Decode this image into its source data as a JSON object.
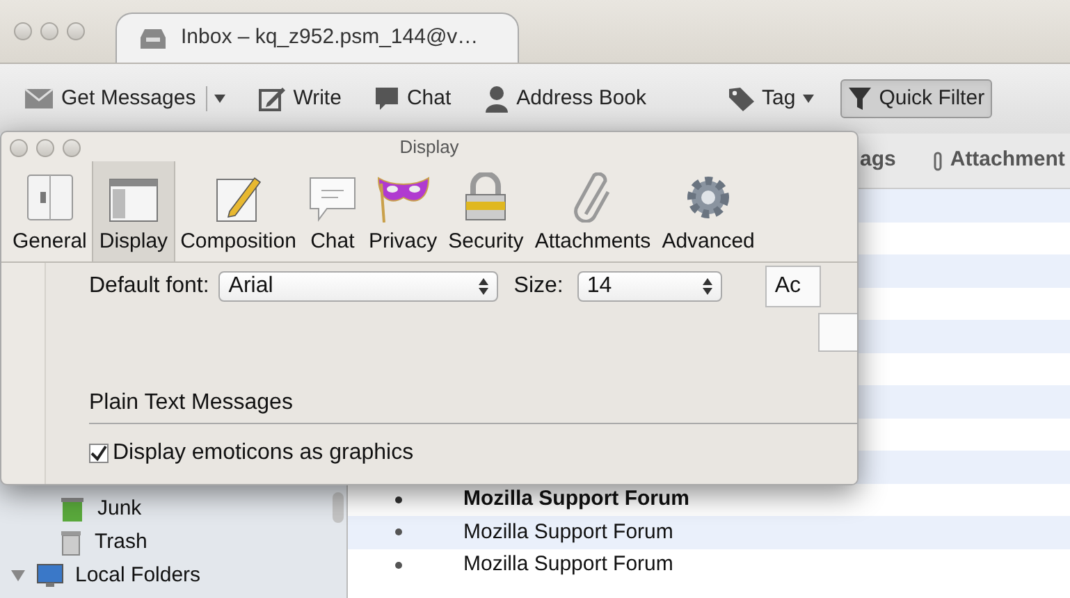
{
  "window": {
    "tab": {
      "title": "Inbox – kq_z952.psm_144@v…",
      "selected": true
    }
  },
  "toolbar": [
    {
      "label": "Get Messages",
      "kind": "split",
      "pressed": false
    },
    {
      "label": "Write",
      "kind": "button",
      "pressed": false
    },
    {
      "label": "Chat",
      "kind": "button",
      "pressed": false
    },
    {
      "label": "Address Book",
      "kind": "button",
      "pressed": false
    },
    {
      "label": "Tag",
      "kind": "menu",
      "pressed": false
    },
    {
      "label": "Quick Filter",
      "kind": "button",
      "pressed": true
    }
  ],
  "folders": [
    {
      "name": "Junk",
      "kind": "junk"
    },
    {
      "name": "Trash",
      "kind": "trash"
    }
  ],
  "local_folders": {
    "name": "Local Folders",
    "expanded": true
  },
  "message_list": {
    "columns": [
      "ags",
      "Attachment"
    ],
    "rows": [
      {
        "subject": "Mozilla Support Forum",
        "unread": true
      },
      {
        "subject": "Mozilla Support Forum",
        "unread": false
      },
      {
        "subject": "Mozilla Support Forum",
        "unread": false
      }
    ]
  },
  "dialog": {
    "title": "Display",
    "panes": [
      {
        "label": "General",
        "selected": false
      },
      {
        "label": "Display",
        "selected": true
      },
      {
        "label": "Composition",
        "selected": false
      },
      {
        "label": "Chat",
        "selected": false
      },
      {
        "label": "Privacy",
        "selected": false
      },
      {
        "label": "Security",
        "selected": false
      },
      {
        "label": "Attachments",
        "selected": false
      },
      {
        "label": "Advanced",
        "selected": false
      }
    ],
    "fonts": {
      "default_font_label": "Default font:",
      "default_font": "Arial",
      "size_label": "Size:",
      "size": "14",
      "advanced_button": "Ac"
    },
    "plain_text": {
      "heading": "Plain Text Messages",
      "options": [
        {
          "label": "Display emoticons as graphics",
          "checked": true
        }
      ]
    }
  }
}
